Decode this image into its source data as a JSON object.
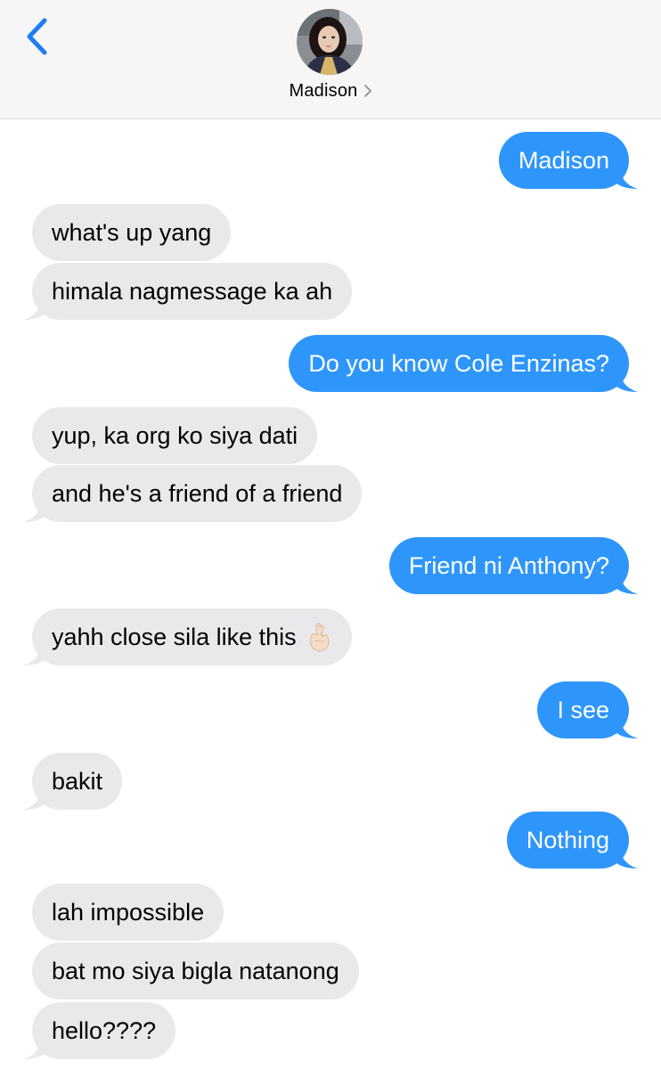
{
  "header": {
    "contact_name": "Madison",
    "back_icon": "chevron-left-icon",
    "name_chevron_icon": "chevron-right-icon",
    "avatar_icon": "contact-avatar"
  },
  "colors": {
    "sent_bubble": "#2e96fb",
    "received_bubble": "#e9e9eb",
    "accent": "#1f7cf4",
    "header_background": "#f6f6f7"
  },
  "messages": [
    {
      "direction": "sent",
      "text": "Madison"
    },
    {
      "direction": "received",
      "text": "what's up yang"
    },
    {
      "direction": "received",
      "text": "himala nagmessage ka ah"
    },
    {
      "direction": "sent",
      "text": "Do you know Cole Enzinas?"
    },
    {
      "direction": "received",
      "text": "yup, ka org ko siya dati"
    },
    {
      "direction": "received",
      "text": "and he's a friend of a friend"
    },
    {
      "direction": "sent",
      "text": "Friend ni Anthony?"
    },
    {
      "direction": "received",
      "text": "yahh close sila like this",
      "emoji": "crossed-fingers-icon"
    },
    {
      "direction": "sent",
      "text": "I see"
    },
    {
      "direction": "received",
      "text": "bakit"
    },
    {
      "direction": "sent",
      "text": "Nothing"
    },
    {
      "direction": "received",
      "text": "lah impossible"
    },
    {
      "direction": "received",
      "text": "bat mo siya bigla natanong"
    },
    {
      "direction": "received",
      "text": "hello????"
    }
  ]
}
